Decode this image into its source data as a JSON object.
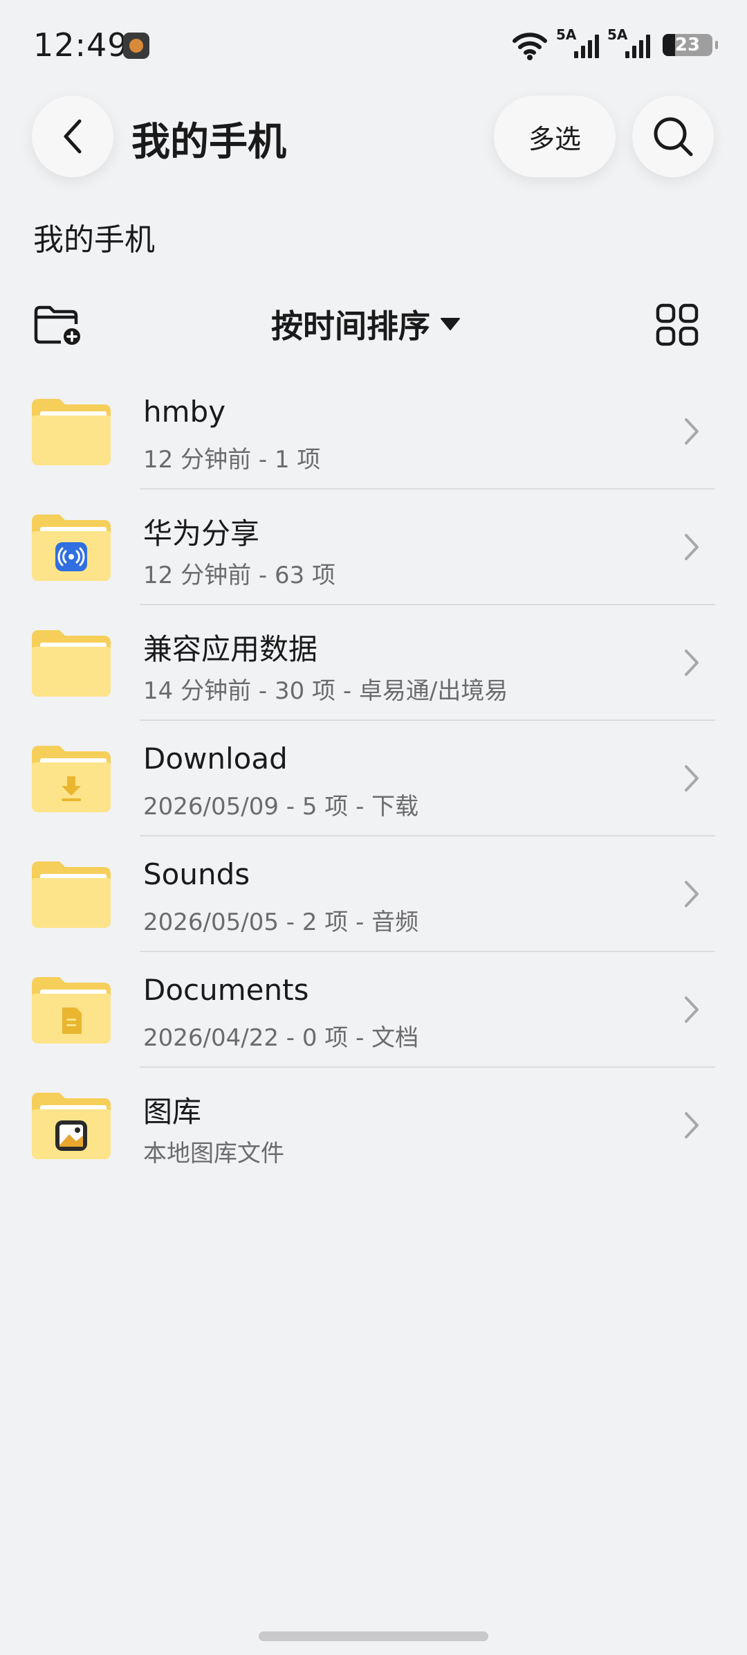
{
  "status_bar": {
    "time": "12:49",
    "app_icon": "lion-app-icon",
    "network1": "5A",
    "network2": "5A",
    "battery": "23"
  },
  "header": {
    "back_icon": "chevron-left-icon",
    "title": "我的手机",
    "multi_select_label": "多选",
    "search_icon": "search-icon"
  },
  "breadcrumb": "我的手机",
  "toolbar": {
    "new_folder_icon": "new-folder-icon",
    "sort_label": "按时间排序",
    "sort_icon": "caret-down-icon",
    "view_icon": "grid-view-icon"
  },
  "files": [
    {
      "name": "hmby",
      "meta": "12 分钟前 - 1 项",
      "icon": "folder-icon"
    },
    {
      "name": "华为分享",
      "meta": "12 分钟前 - 63 项",
      "icon": "huawei-share-folder-icon"
    },
    {
      "name": "兼容应用数据",
      "meta": "14 分钟前 - 30 项 - 卓易通/出境易",
      "icon": "folder-icon"
    },
    {
      "name": "Download",
      "meta": "2026/05/09 - 5 项 - 下载",
      "icon": "download-folder-icon"
    },
    {
      "name": "Sounds",
      "meta": "2026/05/05 - 2 项 - 音频",
      "icon": "folder-icon"
    },
    {
      "name": "Documents",
      "meta": "2026/04/22 - 0 项 - 文档",
      "icon": "documents-folder-icon"
    },
    {
      "name": "图库",
      "meta": "本地图库文件",
      "icon": "gallery-folder-icon"
    }
  ],
  "colors": {
    "background": "#f1f2f4",
    "folder_back": "#f6cf5a",
    "folder_front": "#fde48a",
    "share_badge": "#2f6fe0"
  }
}
